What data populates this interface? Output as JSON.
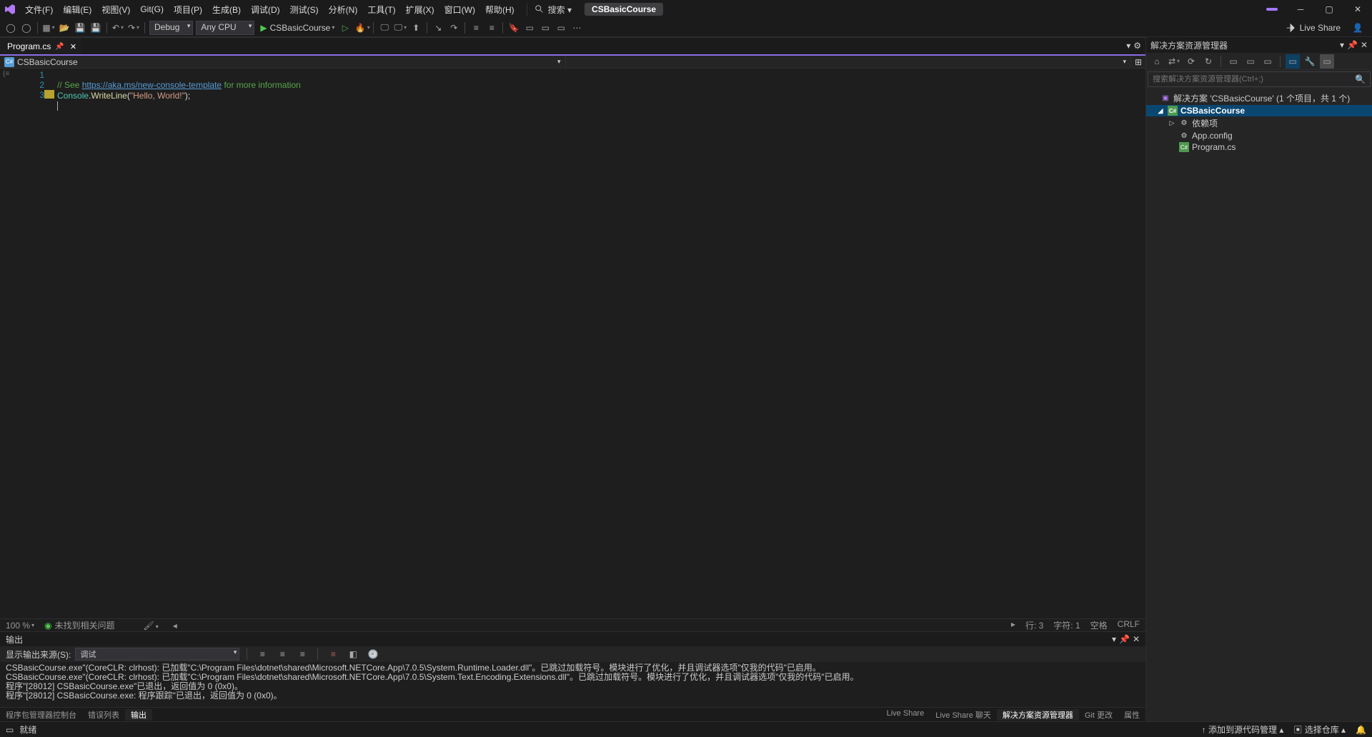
{
  "menu": [
    "文件(F)",
    "编辑(E)",
    "视图(V)",
    "Git(G)",
    "项目(P)",
    "生成(B)",
    "调试(D)",
    "测试(S)",
    "分析(N)",
    "工具(T)",
    "扩展(X)",
    "窗口(W)",
    "帮助(H)"
  ],
  "search_label": "搜索 ▾",
  "project_name": "CSBasicCourse",
  "toolbar": {
    "config": "Debug",
    "platform": "Any CPU",
    "run_target": "CSBasicCourse",
    "liveshare": "Live Share"
  },
  "tab": {
    "name": "Program.cs"
  },
  "nav_dropdown": "CSBasicCourse",
  "code": {
    "line1": {
      "comment": "// See ",
      "link": "https://aka.ms/new-console-template",
      "rest": " for more information"
    },
    "line2": {
      "type": "Console",
      "dot": ".",
      "method": "WriteLine",
      "paren": "(",
      "str": "\"Hello, World!\"",
      "close": ");"
    }
  },
  "editor_status": {
    "zoom": "100 %",
    "issues": "未找到相关问题",
    "line": "行: 3",
    "col": "字符: 1",
    "spaces": "空格",
    "eol": "CRLF"
  },
  "output": {
    "title": "输出",
    "source_label": "显示输出来源(S):",
    "source_value": "调试",
    "lines": [
      "CSBasicCourse.exe\"(CoreCLR: clrhost): 已加载\"C:\\Program Files\\dotnet\\shared\\Microsoft.NETCore.App\\7.0.5\\System.Runtime.Loader.dll\"。已跳过加载符号。模块进行了优化，并且调试器选项\"仅我的代码\"已启用。",
      "CSBasicCourse.exe\"(CoreCLR: clrhost): 已加载\"C:\\Program Files\\dotnet\\shared\\Microsoft.NETCore.App\\7.0.5\\System.Text.Encoding.Extensions.dll\"。已跳过加载符号。模块进行了优化，并且调试器选项\"仅我的代码\"已启用。",
      "程序\"[28012] CSBasicCourse.exe\"已退出，返回值为 0 (0x0)。",
      "程序\"[28012] CSBasicCourse.exe: 程序跟踪\"已退出，返回值为 0 (0x0)。"
    ]
  },
  "bottom_tabs": {
    "left": [
      "程序包管理器控制台",
      "错误列表",
      "输出"
    ],
    "right": [
      "Live Share",
      "Live Share 聊天",
      "解决方案资源管理器",
      "Git 更改",
      "属性"
    ]
  },
  "solution": {
    "title": "解决方案资源管理器",
    "search_placeholder": "搜索解决方案资源管理器(Ctrl+;)",
    "root": "解决方案 'CSBasicCourse' (1 个项目，共 1 个)",
    "project": "CSBasicCourse",
    "deps": "依赖项",
    "appconfig": "App.config",
    "program": "Program.cs"
  },
  "statusbar": {
    "ready": "就绪",
    "add_source": "添加到源代码管理 ▴",
    "select_repo": "选择仓库 ▴"
  }
}
